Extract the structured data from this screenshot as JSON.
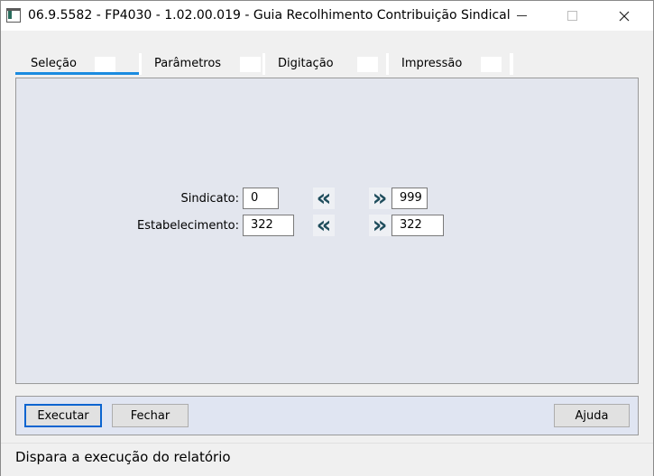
{
  "window": {
    "title": "06.9.5582 - FP4030 - 1.02.00.019 - Guia Recolhimento Contribuição Sindical"
  },
  "tabs": [
    {
      "label": "Seleção",
      "active": true
    },
    {
      "label": "Parâmetros",
      "active": false
    },
    {
      "label": "Digitação",
      "active": false
    },
    {
      "label": "Impressão",
      "active": false
    }
  ],
  "form": {
    "sindicato": {
      "label": "Sindicato:",
      "from": "0",
      "to": "999"
    },
    "estabelecimento": {
      "label": "Estabelecimento:",
      "from": "322",
      "to": "322"
    }
  },
  "buttons": {
    "executar": "Executar",
    "fechar": "Fechar",
    "ajuda": "Ajuda"
  },
  "status": {
    "text": "Dispara a execução do relatório"
  },
  "icons": {
    "first": "chevron-double-left-icon",
    "last": "chevron-double-right-icon"
  },
  "colors": {
    "tab_active_underline": "#1a8be0",
    "panel_background": "#e3e6ee",
    "chevron": "#1f4d5c"
  }
}
